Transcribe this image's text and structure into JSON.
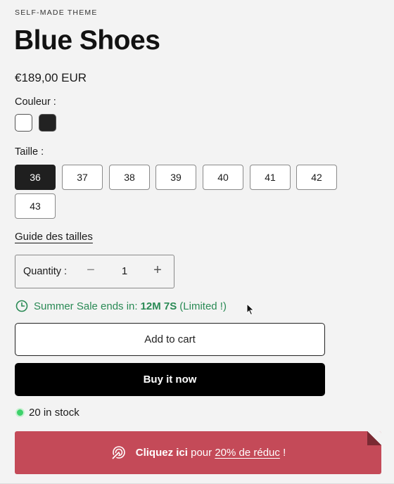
{
  "product": {
    "vendor": "SELF-MADE THEME",
    "title": "Blue Shoes",
    "price": "€189,00 EUR"
  },
  "color": {
    "label": "Couleur :",
    "options": [
      {
        "name": "white",
        "hex": "#ffffff"
      },
      {
        "name": "black",
        "hex": "#222222"
      }
    ]
  },
  "size": {
    "label": "Taille :",
    "options": [
      "36",
      "37",
      "38",
      "39",
      "40",
      "41",
      "42",
      "43"
    ],
    "selected": "36"
  },
  "size_guide": "Guide des tailles",
  "quantity": {
    "label": "Quantity :",
    "minus": "−",
    "value": "1",
    "plus": "+"
  },
  "sale": {
    "icon": "clock-icon",
    "prefix": "Summer Sale ends in:",
    "countdown": "12M 7S",
    "suffix": "(Limited !)",
    "color": "#2a8a55"
  },
  "buttons": {
    "add_to_cart": "Add to cart",
    "buy_now": "Buy it now"
  },
  "stock": {
    "text": "20 in stock",
    "dot_color": "#3dd16a"
  },
  "promo": {
    "icon": "click-icon",
    "bold": "Cliquez ici",
    "middle": "pour",
    "link": "20% de réduc",
    "end": "!",
    "background": "#c44a58"
  }
}
